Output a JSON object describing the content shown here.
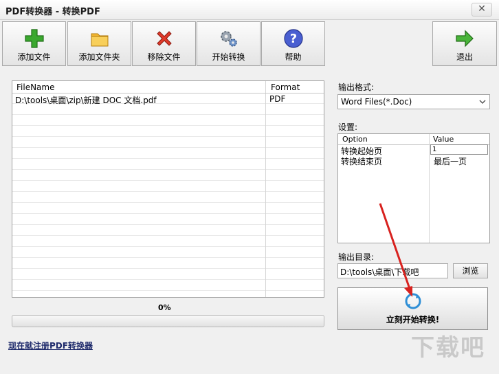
{
  "window": {
    "title": "PDF转换器 - 转换PDF",
    "close_label": "✕"
  },
  "toolbar": {
    "add_file": "添加文件",
    "add_folder": "添加文件夹",
    "remove_file": "移除文件",
    "start_convert": "开始转换",
    "help": "帮助",
    "exit": "退出"
  },
  "filelist": {
    "columns": [
      "FileName",
      "Format"
    ],
    "rows": [
      {
        "name": "D:\\tools\\桌面\\zip\\新建 DOC 文档.pdf",
        "format": "PDF"
      }
    ]
  },
  "progress": {
    "text": "0%",
    "value": 0
  },
  "register_link": "现在就注册PDF转换器",
  "output_format": {
    "label": "输出格式:",
    "selected": "Word Files(*.Doc)"
  },
  "settings": {
    "label": "设置:",
    "columns": [
      "Option",
      "Value"
    ],
    "rows": [
      {
        "option": "转换起始页",
        "value": "1"
      },
      {
        "option": "转换结束页",
        "value": "最后一页"
      }
    ]
  },
  "output_dir": {
    "label": "输出目录:",
    "value": "D:\\tools\\桌面\\下载吧",
    "browse": "浏览"
  },
  "start_now": "立刻开始转换!",
  "watermark": "下载吧"
}
